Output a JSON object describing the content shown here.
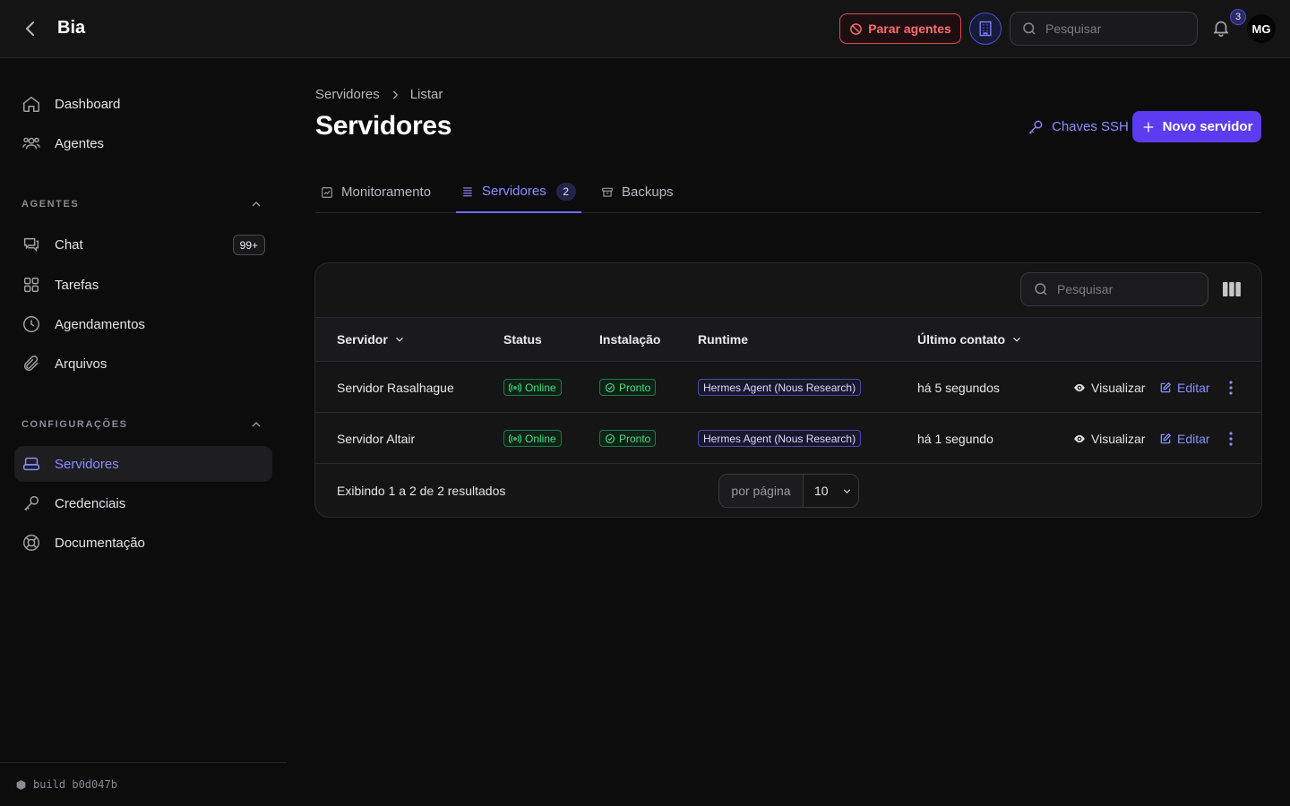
{
  "header": {
    "back_icon": "chevron-left-icon",
    "title": "Bia",
    "stop_agents_label": "Parar agentes",
    "search_placeholder": "Pesquisar",
    "notifications_count": "3",
    "avatar_initials": "MG",
    "colors": {
      "danger": "#e5484d",
      "accent": "#5b3cf0"
    }
  },
  "sidebar": {
    "top_items": [
      {
        "label": "Dashboard",
        "icon": "home-icon"
      },
      {
        "label": "Agentes",
        "icon": "users-icon"
      }
    ],
    "sections": [
      {
        "title": "AGENTES",
        "items": [
          {
            "label": "Chat",
            "icon": "chat-icon",
            "badge": "99+"
          },
          {
            "label": "Tarefas",
            "icon": "grid-icon"
          },
          {
            "label": "Agendamentos",
            "icon": "clock-icon"
          },
          {
            "label": "Arquivos",
            "icon": "paperclip-icon"
          }
        ]
      },
      {
        "title": "CONFIGURAÇÕES",
        "items": [
          {
            "label": "Servidores",
            "icon": "server-icon",
            "active": true
          },
          {
            "label": "Credenciais",
            "icon": "key-icon"
          },
          {
            "label": "Documentação",
            "icon": "lifebuoy-icon"
          }
        ]
      }
    ],
    "build": "build b0d047b"
  },
  "main": {
    "breadcrumb": [
      "Servidores",
      "Listar"
    ],
    "title": "Servidores",
    "ssh_keys_label": "Chaves SSH",
    "new_server_label": "Novo servidor",
    "tabs": [
      {
        "label": "Monitoramento"
      },
      {
        "label": "Servidores",
        "count": "2",
        "active": true
      },
      {
        "label": "Backups"
      }
    ],
    "table": {
      "search_placeholder": "Pesquisar",
      "columns": [
        "Servidor",
        "Status",
        "Instalação",
        "Runtime",
        "Último contato"
      ],
      "rows": [
        {
          "name": "Servidor Rasalhague",
          "status": "Online",
          "install": "Pronto",
          "runtime": "Hermes Agent (Nous Research)",
          "last_contact": "há 5 segundos",
          "view": "Visualizar",
          "edit": "Editar"
        },
        {
          "name": "Servidor Altair",
          "status": "Online",
          "install": "Pronto",
          "runtime": "Hermes Agent (Nous Research)",
          "last_contact": "há 1 segundo",
          "view": "Visualizar",
          "edit": "Editar"
        }
      ],
      "results_text": "Exibindo 1 a 2 de 2 resultados",
      "per_page_label": "por página",
      "per_page_value": "10"
    }
  }
}
